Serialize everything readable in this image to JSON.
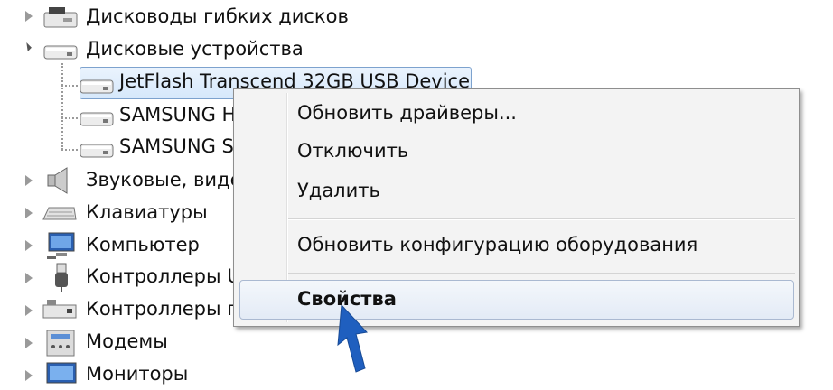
{
  "tree": {
    "items": [
      {
        "label": "Дисководы гибких дисков",
        "expanded": false,
        "icon": "floppy-drive-icon"
      },
      {
        "label": "Дисковые устройства",
        "expanded": true,
        "icon": "disk-drive-icon"
      },
      {
        "label": "JetFlash Transcend 32GB USB Device",
        "child": true,
        "selected": true,
        "icon": "disk-drive-icon"
      },
      {
        "label": "SAMSUNG H",
        "child": true,
        "icon": "disk-drive-icon"
      },
      {
        "label": "SAMSUNG S",
        "child": true,
        "icon": "disk-drive-icon"
      },
      {
        "label": "Звуковые, виде",
        "expanded": false,
        "icon": "speaker-icon"
      },
      {
        "label": "Клавиатуры",
        "expanded": false,
        "icon": "keyboard-icon"
      },
      {
        "label": "Компьютер",
        "expanded": false,
        "icon": "computer-icon"
      },
      {
        "label": "Контроллеры U",
        "expanded": false,
        "icon": "usb-icon"
      },
      {
        "label": "Контроллеры г",
        "expanded": false,
        "icon": "controller-icon"
      },
      {
        "label": "Модемы",
        "expanded": false,
        "icon": "modem-icon"
      },
      {
        "label": "Мониторы",
        "expanded": false,
        "icon": "monitor-icon"
      }
    ]
  },
  "context_menu": {
    "items": [
      {
        "label": "Обновить драйверы..."
      },
      {
        "label": "Отключить"
      },
      {
        "label": "Удалить"
      },
      {
        "label": "Обновить конфигурацию оборудования"
      },
      {
        "label": "Свойства",
        "bold": true,
        "highlighted": true
      }
    ]
  },
  "colors": {
    "selection": "#d6e8fb",
    "menu_bg": "#f3f3f3",
    "pointer": "#1f5fbf"
  }
}
